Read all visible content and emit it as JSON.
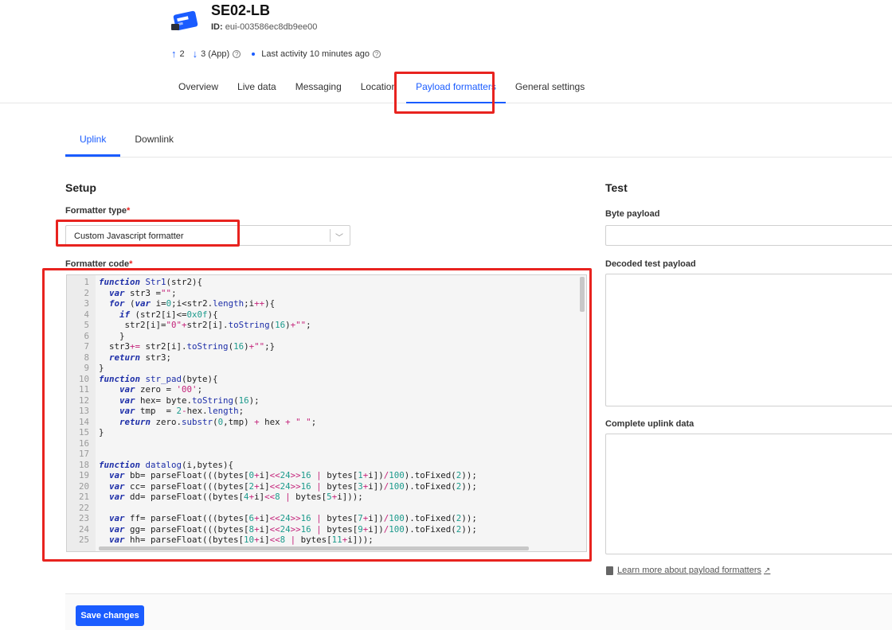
{
  "device": {
    "name": "SE02-LB",
    "id_label": "ID:",
    "id_value": "eui-003586ec8db9ee00"
  },
  "stats": {
    "uplink_count": "2",
    "downlink_count": "3 (App)",
    "last_activity": "Last activity 10 minutes ago"
  },
  "tabs": [
    {
      "label": "Overview"
    },
    {
      "label": "Live data"
    },
    {
      "label": "Messaging"
    },
    {
      "label": "Location"
    },
    {
      "label": "Payload formatters"
    },
    {
      "label": "General settings"
    }
  ],
  "subtabs": [
    {
      "label": "Uplink"
    },
    {
      "label": "Downlink"
    }
  ],
  "setup": {
    "title": "Setup",
    "formatter_type_label": "Formatter type",
    "formatter_type_value": "Custom Javascript formatter",
    "formatter_code_label": "Formatter code",
    "required_mark": "*"
  },
  "code_lines": [
    "function Str1(str2){",
    "  var str3 =\"\";",
    "  for (var i=0;i<str2.length;i++){",
    "    if (str2[i]<=0x0f){",
    "     str2[i]=\"0\"+str2[i].toString(16)+\"\";",
    "    }",
    "  str3+= str2[i].toString(16)+\"\";}",
    "  return str3;",
    "}",
    "function str_pad(byte){",
    "    var zero = '00';",
    "    var hex= byte.toString(16);",
    "    var tmp  = 2-hex.length;",
    "    return zero.substr(0,tmp) + hex + \" \";",
    "}",
    "",
    "",
    "function datalog(i,bytes){",
    "  var bb= parseFloat(((bytes[0+i]<<24>>16 | bytes[1+i])/100).toFixed(2));",
    "  var cc= parseFloat(((bytes[2+i]<<24>>16 | bytes[3+i])/100).toFixed(2));",
    "  var dd= parseFloat((bytes[4+i]<<8 | bytes[5+i]));",
    "",
    "  var ff= parseFloat(((bytes[6+i]<<24>>16 | bytes[7+i])/100).toFixed(2));",
    "  var gg= parseFloat(((bytes[8+i]<<24>>16 | bytes[9+i])/100).toFixed(2));",
    "  var hh= parseFloat((bytes[10+i]<<8 | bytes[11+i]));"
  ],
  "test": {
    "title": "Test",
    "byte_payload_label": "Byte payload",
    "decoded_label": "Decoded test payload",
    "complete_label": "Complete uplink data",
    "learn_more": "Learn more about payload formatters"
  },
  "footer": {
    "save_label": "Save changes"
  },
  "colors": {
    "accent": "#1a5cff",
    "highlight_box": "#e8231f"
  },
  "icons": [
    "device-icon",
    "arrow-up-icon",
    "arrow-down-icon",
    "help-icon",
    "chevron-down-icon",
    "book-icon",
    "external-link-icon"
  ]
}
